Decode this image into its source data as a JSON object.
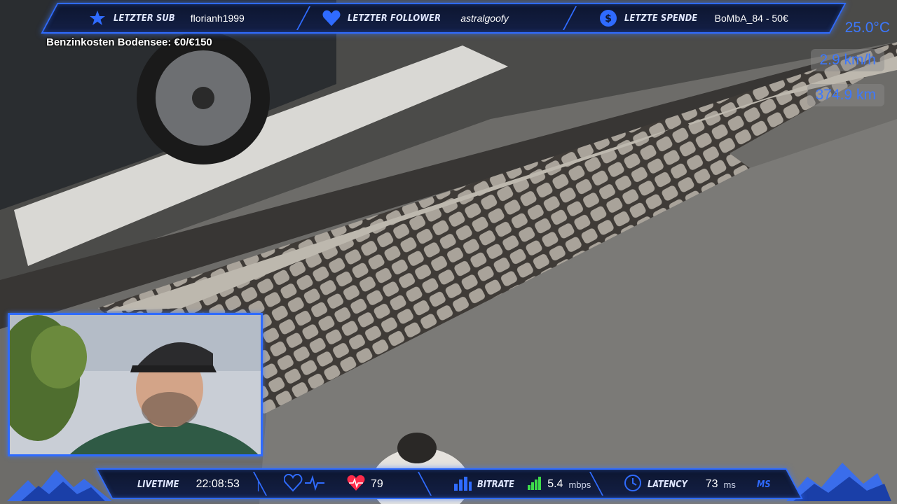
{
  "top_bar": {
    "sub": {
      "icon": "star-icon",
      "label": "LETZTER SUB",
      "value": "florianh1999"
    },
    "follower": {
      "icon": "heart-icon",
      "label": "LETZTER FOLLOWER",
      "value": "astralgoofy"
    },
    "donation": {
      "icon": "dollar-coin-icon",
      "label": "LETZTE SPENDE",
      "value": "BoMbA_84 - 50€"
    }
  },
  "fuel_costs": "Benzinkosten Bodensee: €0/€150",
  "stats": {
    "temperature": "25.0°C",
    "speed": "2.9 km/h",
    "distance": "374.9 km"
  },
  "bottom_bar": {
    "livetime": {
      "label": "LIVETIME",
      "value": "22:08:53"
    },
    "heart_rate": {
      "icon": "heart-pulse-icon",
      "value": "79"
    },
    "bitrate": {
      "icon": "bar-chart-icon",
      "label": "BITRATE",
      "value": "5.4",
      "unit": "mbps"
    },
    "latency": {
      "icon": "clock-icon",
      "label": "LATENCY",
      "value": "73",
      "unit": "ms",
      "unit_tag": "MS"
    }
  },
  "colors": {
    "accent": "#2f6bff",
    "bar_bg": "#0d1630",
    "stat_text": "#3c78ff",
    "signal_green": "#3ddc4a",
    "heart_red": "#ff2b4a"
  }
}
